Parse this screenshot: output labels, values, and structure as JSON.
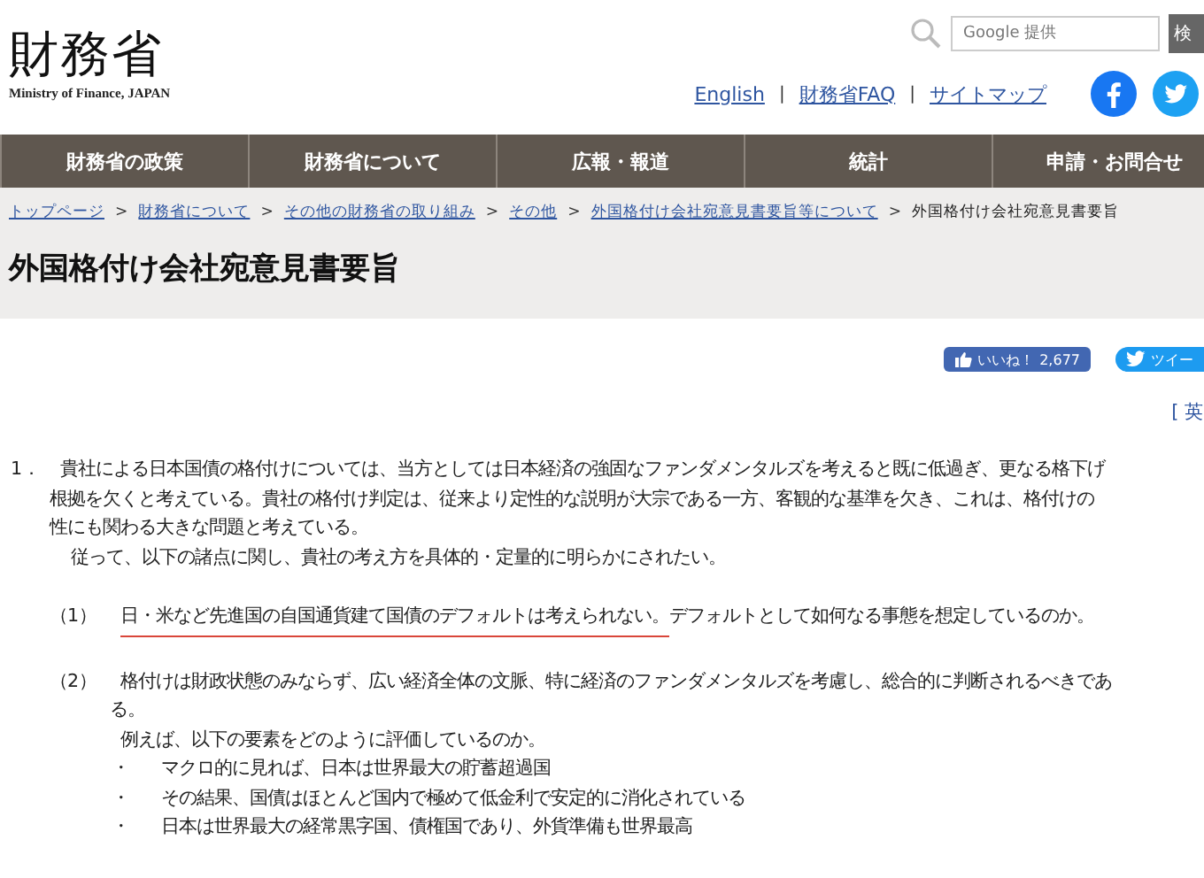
{
  "header": {
    "logo": {
      "title": "財務省",
      "subtitle": "Ministry of Finance, JAPAN"
    },
    "search": {
      "placeholder": "Google 提供",
      "button": "検"
    },
    "links": [
      {
        "kind": "link",
        "label": "English"
      },
      {
        "kind": "separator",
        "label": "|"
      },
      {
        "kind": "link",
        "label": "財務省FAQ"
      },
      {
        "kind": "separator",
        "label": "|"
      },
      {
        "kind": "link",
        "label": "サイトマップ"
      }
    ]
  },
  "nav": [
    "財務省の政策",
    "財務省について",
    "広報・報道",
    "統計",
    "申請・お問合せ"
  ],
  "breadcrumb": [
    {
      "kind": "link",
      "label": "トップページ",
      "separator": ">"
    },
    {
      "kind": "link",
      "label": "財務省について",
      "separator": ">"
    },
    {
      "kind": "link",
      "label": "その他の財務省の取り組み",
      "separator": ">"
    },
    {
      "kind": "link",
      "label": "その他",
      "separator": ">"
    },
    {
      "kind": "link",
      "label": "外国格付け会社宛意見書要旨等について",
      "separator": ">"
    },
    {
      "kind": "current",
      "label": "外国格付け会社宛意見書要旨"
    }
  ],
  "page_title": "外国格付け会社宛意見書要旨",
  "share": {
    "like": {
      "label": "いいね！",
      "count": "2,677"
    },
    "tweet": {
      "label": "ツイー"
    }
  },
  "language_link": "[ 英",
  "document": [
    {
      "kind": "numbered",
      "number": "1．",
      "lines": [
        {
          "kind": "lead",
          "text": "貴社による日本国債の格付けについては、当方としては日本経済の強固なファンダメンタルズを考えると既に低過ぎ、更なる格下げ"
        },
        {
          "kind": "cont",
          "text": "根拠を欠くと考えている。貴社の格付け判定は、従来より定性的な説明が大宗である一方、客観的な基準を欠き、これは、格付けの"
        },
        {
          "kind": "cont",
          "text": "性にも関わる大きな問題と考えている。"
        },
        {
          "kind": "para",
          "text": "従って、以下の諸点に関し、貴社の考え方を具体的・定量的に明らかにされたい。"
        }
      ]
    },
    {
      "kind": "subitem",
      "number": "（1）",
      "segments": [
        {
          "text": "日・米など先進国の自国通貨建て国債のデフォルトは考えられない。",
          "underlined": true
        },
        {
          "text": "デフォルトとして如何なる事態を想定しているのか。",
          "underlined": false
        }
      ]
    },
    {
      "kind": "subitem",
      "number": "（2）",
      "segments": [
        {
          "text": "格付けは財政状態のみならず、広い経済全体の文脈、特に経済のファンダメンタルズを考慮し、総合的に判断されるべきであ",
          "underlined": false
        }
      ],
      "lines": [
        {
          "kind": "cont",
          "text": "る。"
        },
        {
          "kind": "para",
          "text": "例えば、以下の要素をどのように評価しているのか。"
        }
      ],
      "bullets": [
        {
          "marker": "・",
          "text": "マクロ的に見れば、日本は世界最大の貯蓄超過国"
        },
        {
          "marker": "・",
          "text": "その結果、国債はほとんど国内で極めて低金利で安定的に消化されている"
        },
        {
          "marker": "・",
          "text": "日本は世界最大の経常黒字国、債権国であり、外貨準備も世界最高"
        }
      ]
    }
  ]
}
